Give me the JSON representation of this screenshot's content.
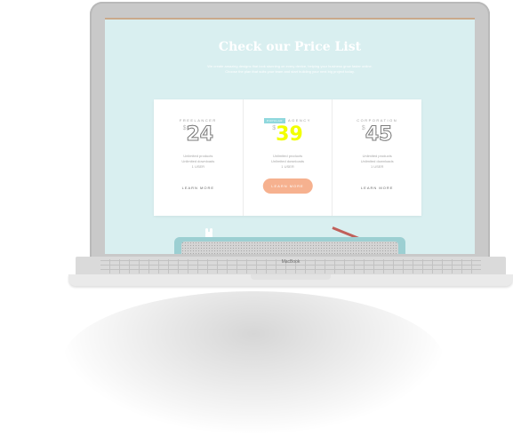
{
  "page": {
    "headline": "Check our Price List",
    "intro": "We create amazing designs that look stunning on every device, helping your business grow faster online. Choose the plan that suits your team and start building your next big project today."
  },
  "plans": [
    {
      "name": "FREELANCER",
      "currency": "$",
      "amount": "24",
      "features": [
        "Unlimited products",
        "Unlimited downloads",
        "1 USER"
      ],
      "cta": "LEARN MORE"
    },
    {
      "name": "AGENCY",
      "badge": "POPULAR",
      "currency": "$",
      "amount": "39",
      "features": [
        "Unlimited products",
        "Unlimited downloads",
        "1 USER"
      ],
      "cta": "LEARN MORE"
    },
    {
      "name": "CORPORATION",
      "currency": "$",
      "amount": "45",
      "features": [
        "Unlimited products",
        "Unlimited downloads",
        "1 USER"
      ],
      "cta": "LEARN MORE"
    }
  ],
  "device": {
    "brand": "MacBook"
  },
  "colors": {
    "screen_bg": "#d9eff0",
    "accent_yellow": "#f2ff00",
    "button": "#f6b18f",
    "badge": "#8fd8dd"
  }
}
